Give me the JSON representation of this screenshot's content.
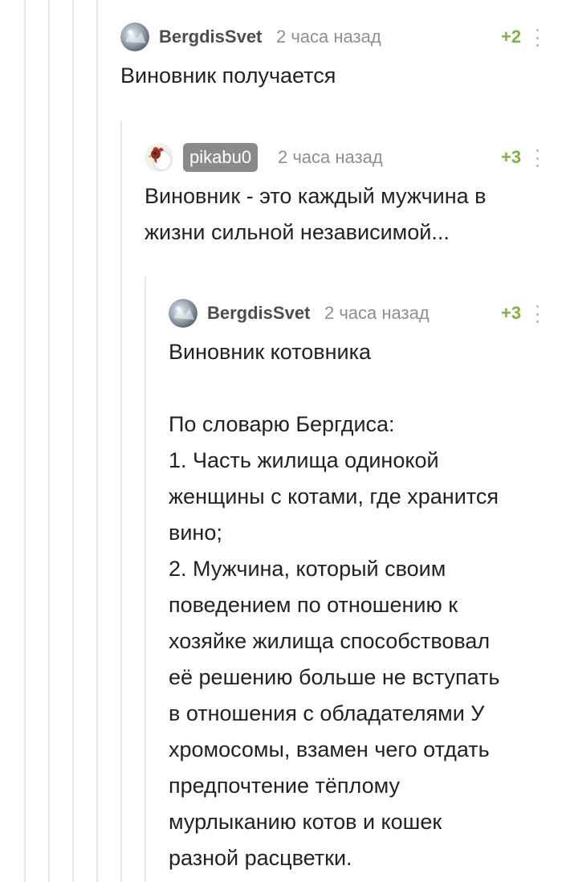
{
  "comments": [
    {
      "author": "BergdisSvet",
      "avatar": "bergdissvet-avatar",
      "time": "2 часа назад",
      "rating": "+2",
      "text": "Виновник получается"
    },
    {
      "author": "pikabu0",
      "avatar": "pikabu0-avatar",
      "time": "2 часа назад",
      "rating": "+3",
      "text": "Виновник - это каждый мужчина в\nжизни сильной независимой..."
    },
    {
      "author": "BergdisSvet",
      "avatar": "bergdissvet-avatar",
      "time": "2 часа назад",
      "rating": "+3",
      "text": "Виновник котовника\n\nПо словарю Бергдиса:\n1. Часть жилища одинокой\nженщины с котами, где хранится\nвино;\n2. Мужчина, который своим\nповедением по отношению к\nхозяйке жилища способствовал\nеё решению больше не вступать\nв отношения с обладателями У\nхромосомы, взамен чего отдать\nпредпочтение тёплому\nмурлыканию котов и кошек\nразной расцветки."
    }
  ],
  "icons": {
    "more": "more-vertical-icon"
  },
  "colors": {
    "rating": "#7cb342",
    "username": "#4d4d4d",
    "time": "#8f8f8f",
    "badge": "#8a8a8a",
    "thread_line": "#e6e6e6"
  }
}
